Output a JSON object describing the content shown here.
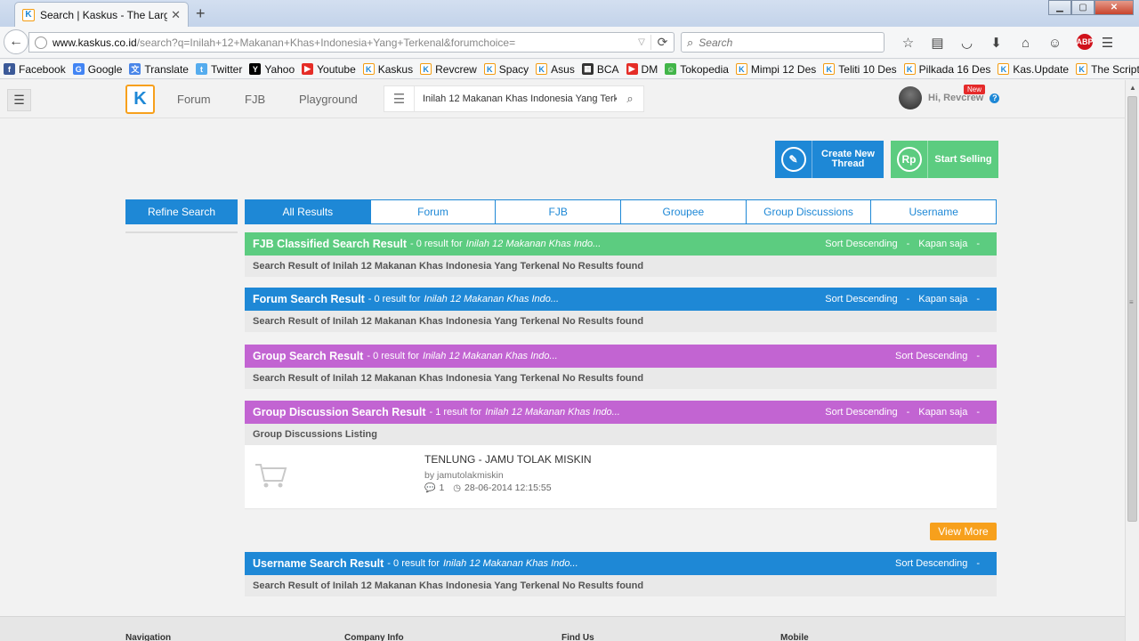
{
  "browser": {
    "tab_title": "Search | Kaskus - The Large...",
    "url_domain": "www.kaskus.co.id",
    "url_path": "/search?q=Inilah+12+Makanan+Khas+Indonesia+Yang+Terkenal&forumchoice=",
    "search_placeholder": "Search",
    "bookmarks": [
      {
        "label": "Facebook",
        "icon": "facebook-icon",
        "color": "#3b5998"
      },
      {
        "label": "Google",
        "icon": "google-icon",
        "color": "#4285f4"
      },
      {
        "label": "Translate",
        "icon": "translate-icon",
        "color": "#4a86e8"
      },
      {
        "label": "Twitter",
        "icon": "twitter-icon",
        "color": "#55acee"
      },
      {
        "label": "Yahoo",
        "icon": "yahoo-icon",
        "color": "#000000"
      },
      {
        "label": "Youtube",
        "icon": "youtube-icon",
        "color": "#e52d27"
      },
      {
        "label": "Kaskus",
        "icon": "kaskus-icon",
        "color": "#1e88d6"
      },
      {
        "label": "Revcrew",
        "icon": "kaskus-icon",
        "color": "#1e88d6"
      },
      {
        "label": "Spacy",
        "icon": "kaskus-icon",
        "color": "#1e88d6"
      },
      {
        "label": "Asus",
        "icon": "kaskus-icon",
        "color": "#1e88d6"
      },
      {
        "label": "BCA",
        "icon": "bca-icon",
        "color": "#333333"
      },
      {
        "label": "DM",
        "icon": "youtube-icon",
        "color": "#e52d27"
      },
      {
        "label": "Tokopedia",
        "icon": "tokopedia-icon",
        "color": "#42b549"
      },
      {
        "label": "Mimpi 12 Des",
        "icon": "kaskus-icon",
        "color": "#1e88d6"
      },
      {
        "label": "Teliti 10 Des",
        "icon": "kaskus-icon",
        "color": "#1e88d6"
      },
      {
        "label": "Pilkada 16 Des",
        "icon": "kaskus-icon",
        "color": "#1e88d6"
      },
      {
        "label": "Kas.Update",
        "icon": "kaskus-icon",
        "color": "#1e88d6"
      },
      {
        "label": "The Script",
        "icon": "kaskus-icon",
        "color": "#1e88d6"
      }
    ]
  },
  "header": {
    "logo": "K",
    "nav": [
      "Forum",
      "FJB",
      "Playground"
    ],
    "search_query": "Inilah 12 Makanan Khas Indonesia Yang Terk",
    "greeting": "Hi, Revcrew",
    "new_badge": "New"
  },
  "actions": {
    "create_thread": "Create New Thread",
    "start_selling": "Start Selling",
    "sell_icon_text": "Rp"
  },
  "refine": {
    "label": "Refine Search"
  },
  "filter_tabs": [
    "All Results",
    "Forum",
    "FJB",
    "Groupee",
    "Group Discussions",
    "Username"
  ],
  "sections": [
    {
      "title": "FJB Classified Search Result",
      "count": "- 0 result for",
      "query": "Inilah 12 Makanan Khas Indo...",
      "sort": "Sort Descending",
      "time": "Kapan saja",
      "body": "Search Result of Inilah 12 Makanan Khas Indonesia Yang Terkenal No Results found",
      "color": "#5ccc80"
    },
    {
      "title": "Forum Search Result",
      "count": "- 0 result for",
      "query": "Inilah 12 Makanan Khas Indo...",
      "sort": "Sort Descending",
      "time": "Kapan saja",
      "body": "Search Result of Inilah 12 Makanan Khas Indonesia Yang Terkenal No Results found",
      "color": "#1e88d6"
    },
    {
      "title": "Group Search Result",
      "count": "- 0 result for",
      "query": "Inilah 12 Makanan Khas Indo...",
      "sort": "Sort Descending",
      "body": "Search Result of Inilah 12 Makanan Khas Indonesia Yang Terkenal No Results found",
      "color": "#c264d2"
    },
    {
      "title": "Group Discussion Search Result",
      "count": "- 1 result for",
      "query": "Inilah 12 Makanan Khas Indo...",
      "sort": "Sort Descending",
      "time": "Kapan saja",
      "body": "Group Discussions Listing",
      "color": "#c264d2"
    },
    {
      "title": "Username Search Result",
      "count": "- 0 result for",
      "query": "Inilah 12 Makanan Khas Indo...",
      "sort": "Sort Descending",
      "body": "Search Result of Inilah 12 Makanan Khas Indonesia Yang Terkenal No Results found",
      "color": "#1e88d6"
    }
  ],
  "listing": {
    "title": "TENLUNG - JAMU TOLAK MISKIN",
    "by": "by jamutolakmiskin",
    "comments": "1",
    "date": "28-06-2014 12:15:55"
  },
  "view_more": "View More",
  "footer": [
    "Navigation",
    "Company Info",
    "Find Us",
    "Mobile"
  ],
  "dash": "-"
}
